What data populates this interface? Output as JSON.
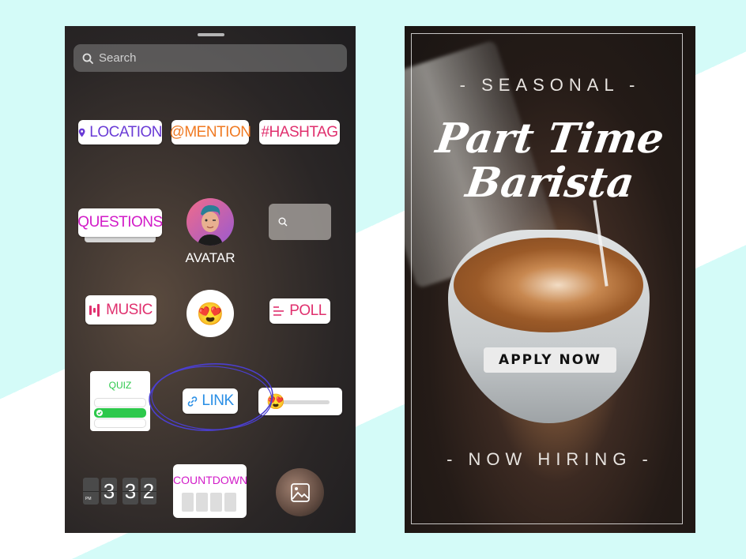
{
  "sticker_tray": {
    "search": {
      "placeholder": "Search"
    },
    "stickers": {
      "location": "LOCATION",
      "mention": "@MENTION",
      "hashtag": "#HASHTAG",
      "questions": "QUESTIONS",
      "avatar": "AVATAR",
      "music": "MUSIC",
      "emoji": "😍",
      "poll": "POLL",
      "quiz": "QUIZ",
      "link": "LINK",
      "slider_emoji": "😍",
      "clock": {
        "period": "PM",
        "digits": [
          "3",
          "3",
          "2"
        ]
      },
      "countdown": "COUNTDOWN"
    },
    "highlight_color": "#4b3fd0"
  },
  "poster": {
    "kicker": "- SEASONAL -",
    "title_line1": "Part Time",
    "title_line2": "Barista",
    "cta": "APPLY NOW",
    "footer": "- NOW HIRING -"
  },
  "colors": {
    "background": "#d4fbf8",
    "location": "#6a3bd6",
    "mention": "#f07a22",
    "hashtag": "#e0306e",
    "questions": "#d21bc8",
    "quiz_green": "#2cc84b",
    "link_blue": "#2a8fe6"
  }
}
